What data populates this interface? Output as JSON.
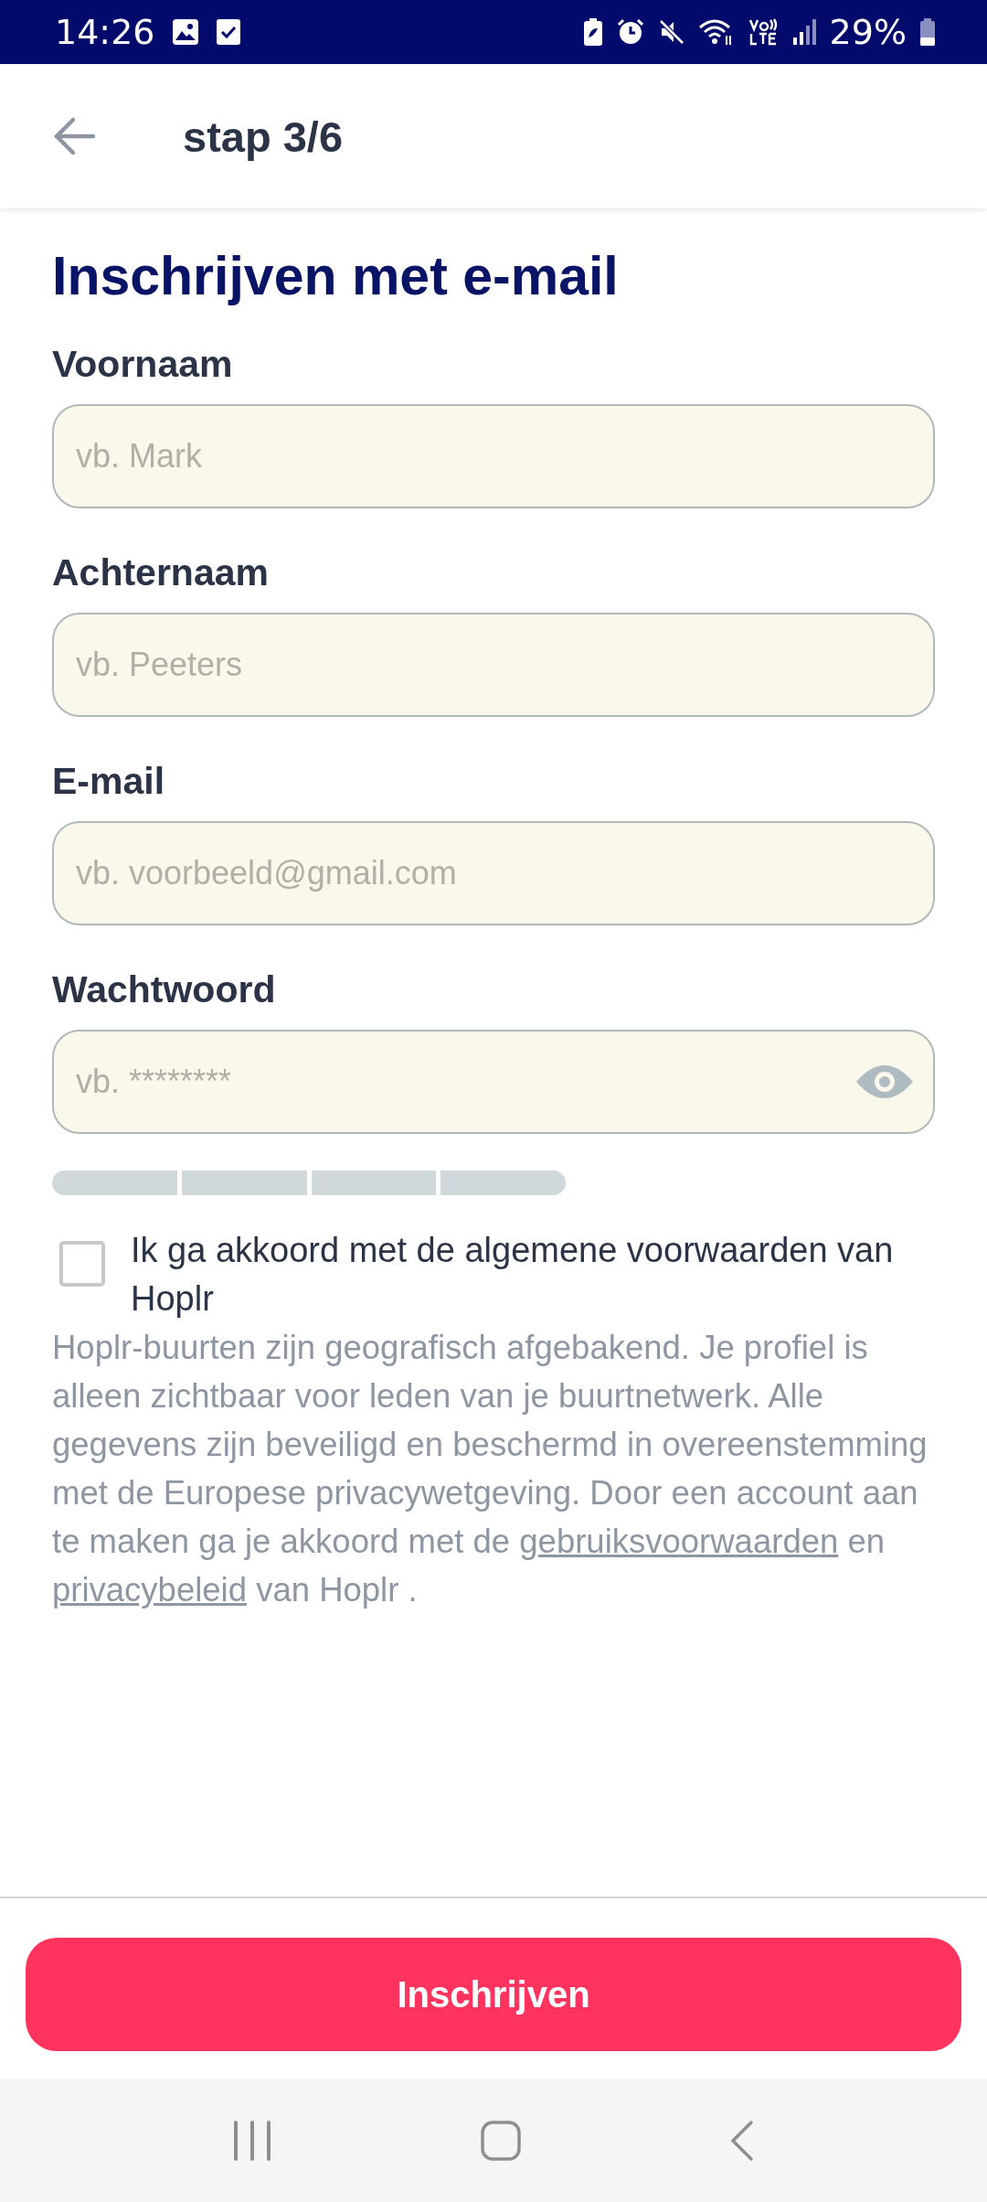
{
  "status_bar": {
    "time": "14:26",
    "battery": "29%"
  },
  "header": {
    "title": "stap 3/6"
  },
  "heading": "Inschrijven met e-mail",
  "fields": [
    {
      "label": "Voornaam",
      "placeholder": "vb. Mark",
      "kind": "text"
    },
    {
      "label": "Achternaam",
      "placeholder": "vb. Peeters",
      "kind": "text"
    },
    {
      "label": "E-mail",
      "placeholder": "vb. voorbeeld@gmail.com",
      "kind": "text"
    },
    {
      "label": "Wachtwoord",
      "placeholder": "vb. ********",
      "kind": "password"
    }
  ],
  "terms": {
    "label": "Ik ga akkoord met de algemene voorwaarden van Hoplr",
    "checked": false
  },
  "notice": [
    {
      "kind": "text",
      "text": "Hoplr-buurten zijn geografisch afgebakend. Je profiel is alleen zichtbaar voor leden van je buurtnetwerk. Alle gegevens zijn beveiligd en beschermd in overeenstemming met de Europese privacywetgeving. Door een account aan te maken ga je akkoord met de "
    },
    {
      "kind": "link",
      "text": "gebruiksvoorwaarden"
    },
    {
      "kind": "text",
      "text": " en "
    },
    {
      "kind": "link",
      "text": "privacybeleid"
    },
    {
      "kind": "text",
      "text": " van Hoplr ."
    }
  ],
  "submit_button": "Inschrijven"
}
